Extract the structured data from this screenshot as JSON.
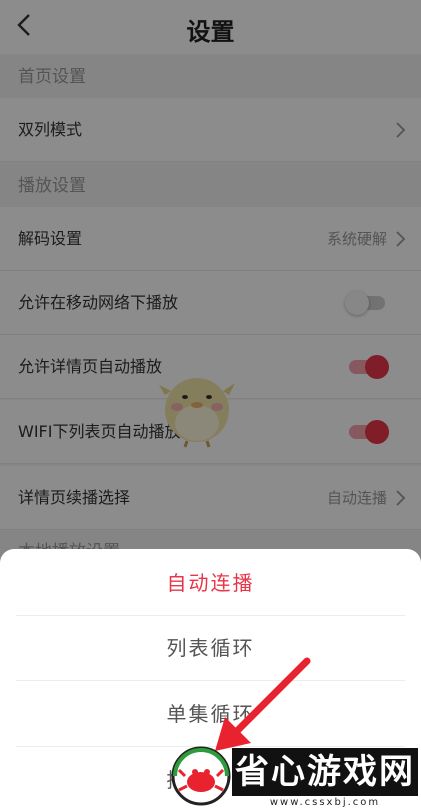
{
  "header": {
    "title": "设置",
    "back_icon": "chevron-left-icon"
  },
  "sections": {
    "home": {
      "title": "首页设置"
    },
    "play": {
      "title": "播放设置"
    },
    "cache": {
      "title": "本地播放设置"
    }
  },
  "rows": {
    "dual_column": {
      "label": "双列模式"
    },
    "decode": {
      "label": "解码设置",
      "value": "系统硬解"
    },
    "mobile_network": {
      "label": "允许在移动网络下播放",
      "enabled": false
    },
    "detail_autoplay": {
      "label": "允许详情页自动播放",
      "enabled": true
    },
    "wifi_autoplay": {
      "label": "WIFI下列表页自动播放",
      "enabled": true
    },
    "continue_play": {
      "label": "详情页续播选择",
      "value": "自动连播"
    }
  },
  "sheet": {
    "options": [
      {
        "label": "自动连播",
        "selected": true
      },
      {
        "label": "列表循环",
        "selected": false
      },
      {
        "label": "单集循环",
        "selected": false
      },
      {
        "label": "播完暂停",
        "selected": false
      }
    ]
  },
  "watermark": {
    "text": "省心游戏网",
    "url": "www.cssxbj.com"
  },
  "colors": {
    "accent": "#e8354a",
    "accent_light": "#f5a3ad",
    "muted": "#9a9a9a"
  }
}
